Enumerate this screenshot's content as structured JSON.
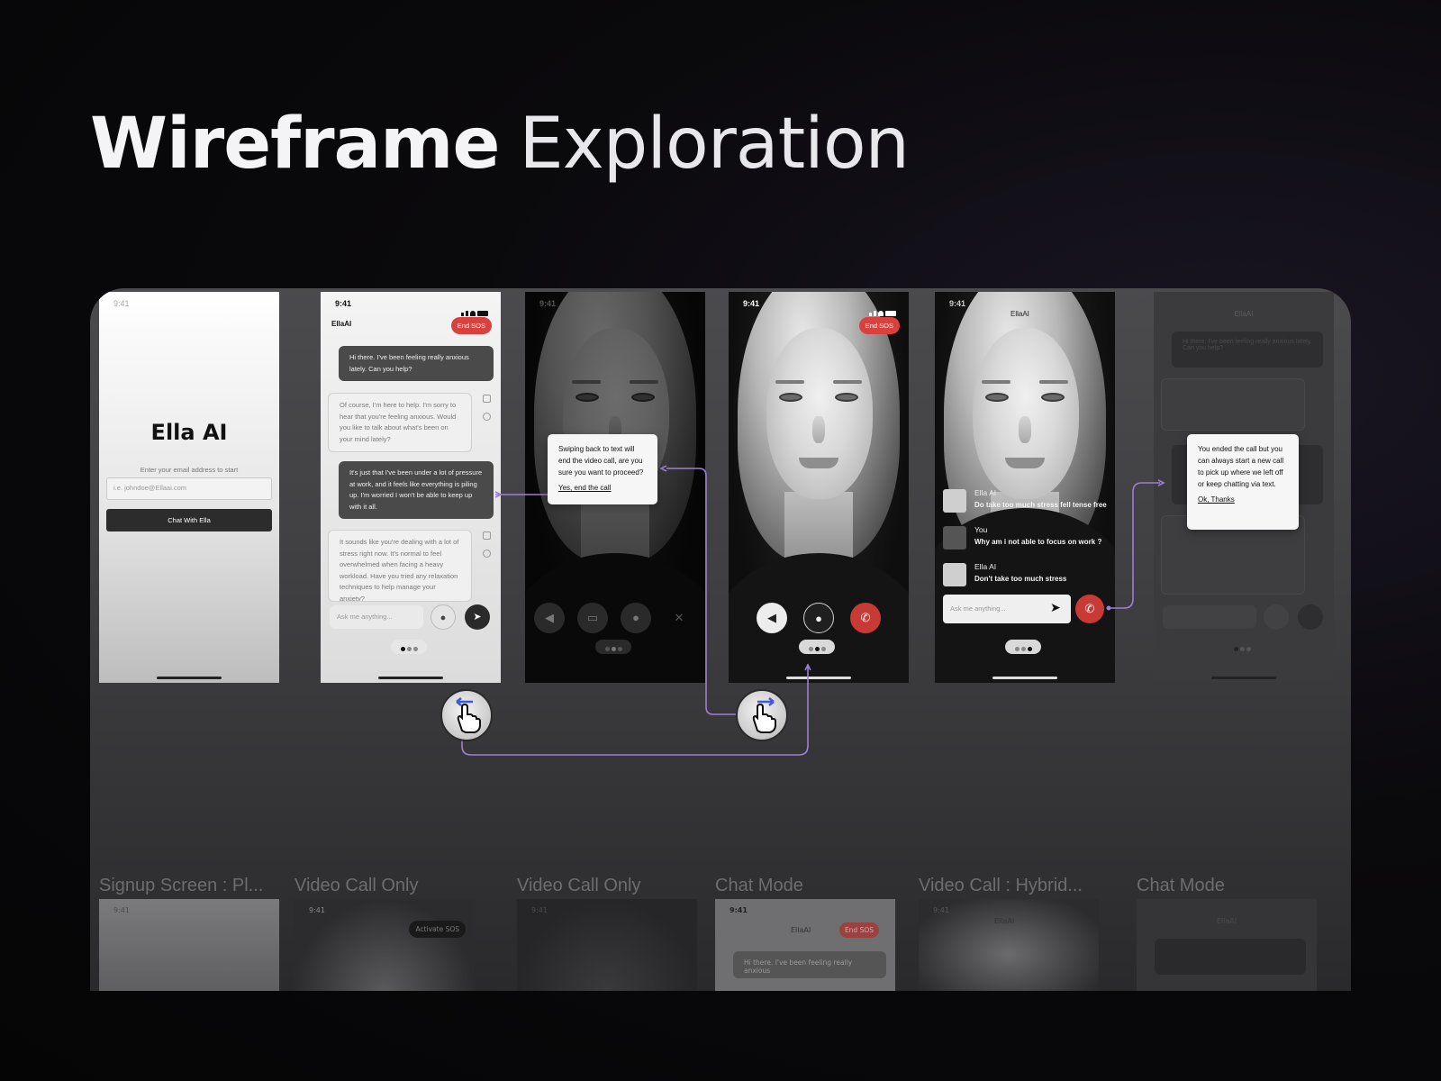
{
  "title": {
    "bold": "Wireframe",
    "light": "Exploration"
  },
  "screens": {
    "signup": {
      "time": "9:41",
      "brand": "Ella AI",
      "prompt": "Enter your email address to start",
      "email_placeholder": "i.e. johndoe@Ellaai.com",
      "cta": "Chat With Ella"
    },
    "chat": {
      "time": "9:41",
      "app_name": "EllaAI",
      "sos": "End SOS",
      "messages": [
        "Hi there. I've been feeling really anxious lately. Can you help?",
        "Of course, I'm here to help. I'm sorry to hear that you're feeling anxious. Would you like to talk about what's been on your mind lately?",
        "It's just that I've been under a lot of pressure at work, and it feels like everything is piling up. I'm worried I won't be able to keep up with it all.",
        "It sounds like you're dealing with a lot of stress right now. It's normal to feel overwhelmed when facing a heavy workload. Have you tried any relaxation techniques to help manage your anxiety?"
      ],
      "input_placeholder": "Ask me anything..."
    },
    "video_dim": {
      "time": "9:41"
    },
    "video_call": {
      "time": "9:41",
      "sos": "End SOS"
    },
    "hybrid": {
      "time": "9:41",
      "app_name": "EllaAI",
      "captions": [
        {
          "name": "Ella AI",
          "text": "Do take too much stress fell tense free"
        },
        {
          "name": "You",
          "text": "Why am i not able to focus on work ?"
        },
        {
          "name": "Ella AI",
          "text": "Don't take too much stress"
        }
      ],
      "input_placeholder": "Ask me anything..."
    },
    "chat_faded": {
      "app_name": "EllaAI",
      "first_message": "Hi there. I've been feeling really anxious lately. Can you help?"
    }
  },
  "dialogs": {
    "swipe_back": {
      "text": "Swiping back to text will end the video call, are you sure you want to proceed?",
      "link": "Yes, end the call"
    },
    "call_ended": {
      "text": "You ended the call but you can always start a new call to pick up where we left off or keep chatting via text.",
      "link": "Ok, Thanks"
    }
  },
  "bottom_labels": [
    "Signup Screen : Pl...",
    "Video Call Only",
    "Video Call Only",
    "Chat Mode",
    "Video Call : Hybrid...",
    "Chat Mode"
  ],
  "thumbnails": {
    "t1_time": "9:41",
    "t2_time": "9:41",
    "t2_sos": "Activate SOS",
    "t3_time": "9:41",
    "t4_time": "9:41",
    "t4_app": "EllaAI",
    "t4_sos": "End SOS",
    "t4_message": "Hi there. I've been feeling really anxious",
    "t5_time": "9:41",
    "t5_app": "EllaAI",
    "t6_app": "EllaAI"
  },
  "colors": {
    "accent_flow": "#9b7fd4",
    "sos_red": "#d8413d",
    "gesture_arrow": "#3d5bd9"
  }
}
